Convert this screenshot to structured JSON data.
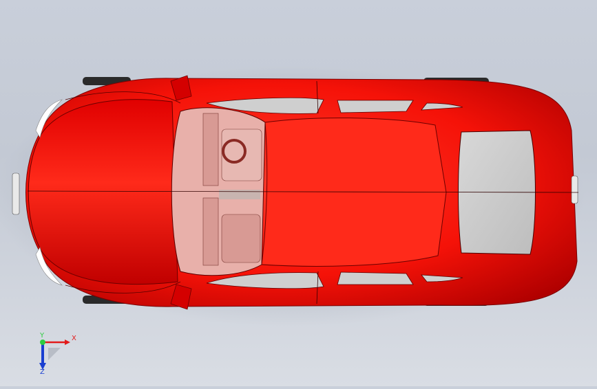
{
  "viewport": {
    "background_top": "#c3c9d4",
    "background_bottom": "#d9dde4",
    "model_color": "#ff1a0d",
    "model_shadow_color": "#9a0000",
    "glass_color": "#cfcfcf"
  },
  "triad": {
    "x_label": "X",
    "y_label": "Y",
    "z_label": "Z",
    "x_color": "#e21a1a",
    "y_color": "#2ecc40",
    "z_color": "#1a3fd1"
  }
}
